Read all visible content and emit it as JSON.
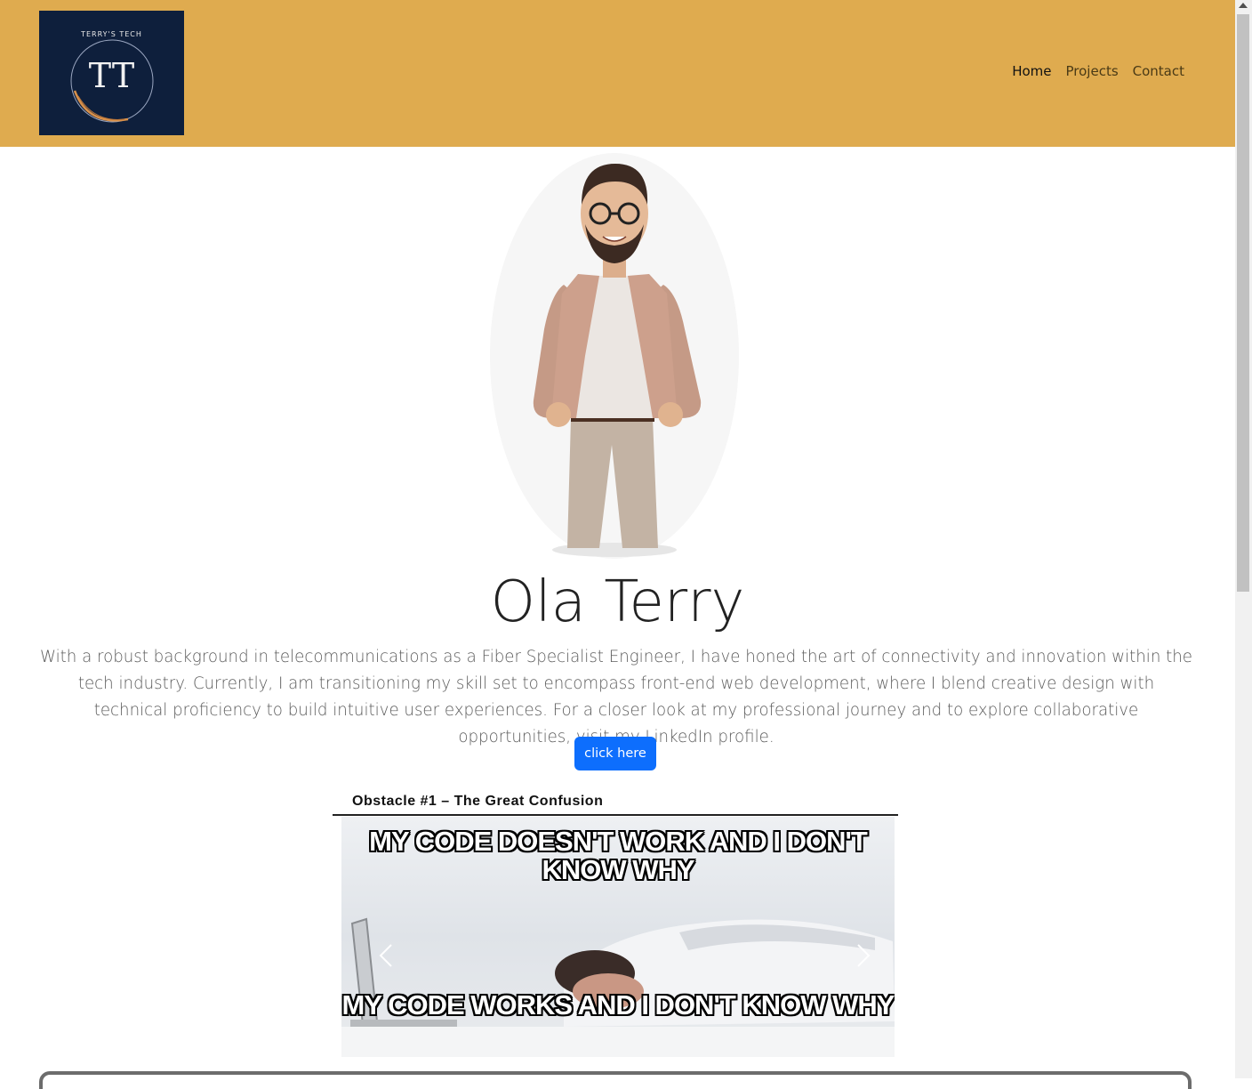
{
  "logo": {
    "top_text": "TERRY'S TECH",
    "monogram": "TT"
  },
  "nav": {
    "items": [
      {
        "label": "Home",
        "active": true
      },
      {
        "label": "Projects",
        "active": false
      },
      {
        "label": "Contact",
        "active": false
      }
    ]
  },
  "hero": {
    "name": "Ola Terry",
    "bio": "With a robust background in telecommunications as a Fiber Specialist Engineer, I have honed the art of connectivity and innovation within the tech industry. Currently, I am transitioning my skill set to encompass front-end web development, where I blend creative design with technical proficiency to build intuitive user experiences. For a closer look at my professional journey and to explore collaborative opportunities, visit my LinkedIn profile.",
    "button_label": "click here"
  },
  "carousel": {
    "caption": "Obstacle #1 – The Great Confusion",
    "meme_top": "MY CODE DOESN'T WORK AND I DON'T KNOW WHY",
    "meme_bottom": "MY CODE WORKS AND I DON'T KNOW WHY"
  },
  "colors": {
    "navbar": "#dfab4f",
    "logo_bg": "#0e1f3c",
    "button": "#0d6efd"
  }
}
